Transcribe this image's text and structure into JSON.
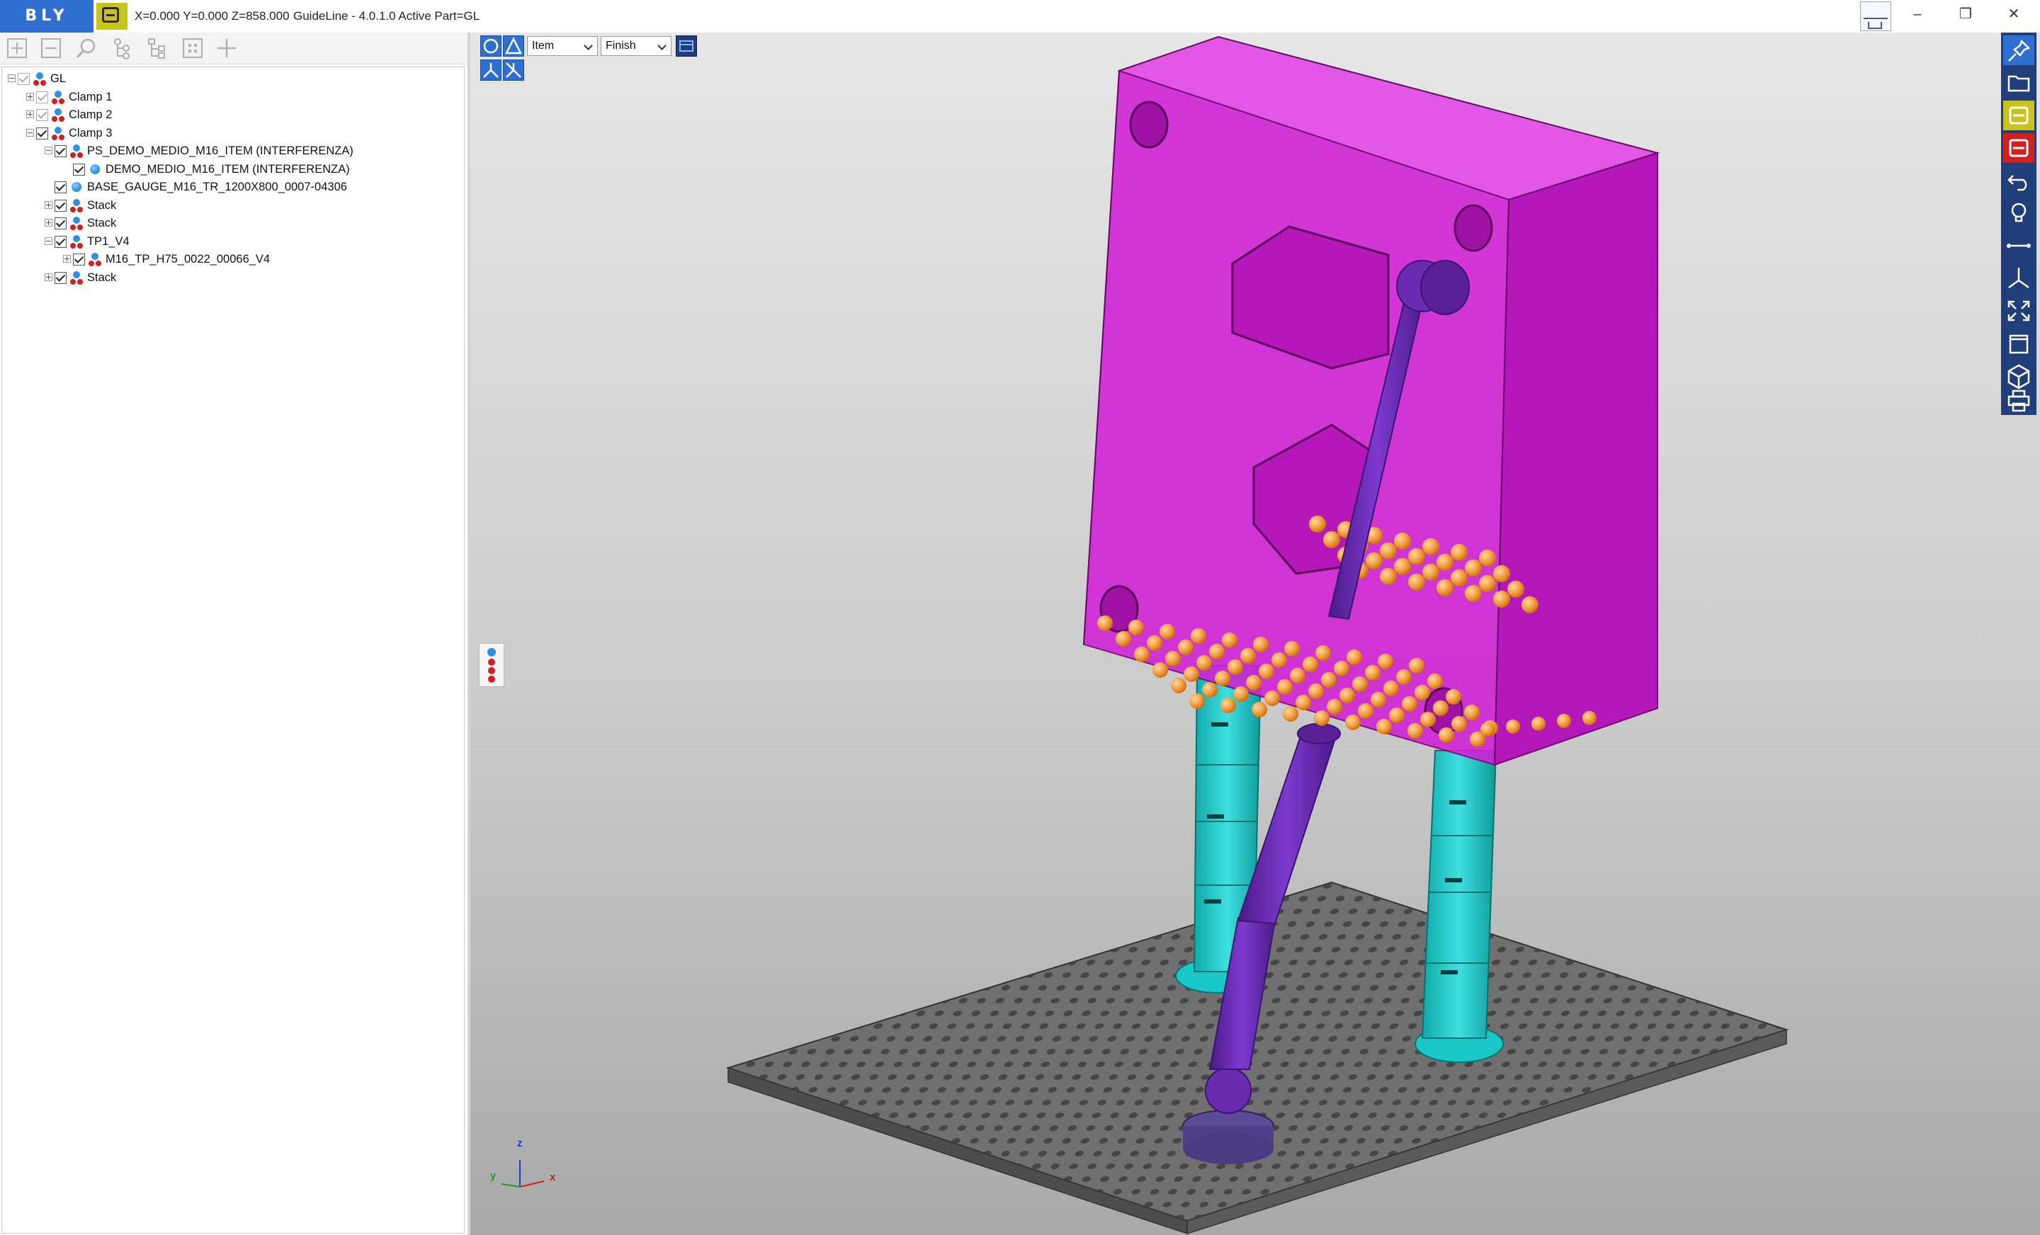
{
  "titlebar": {
    "logo_text": "BLY",
    "coordinates": "X=0.000 Y=0.000 Z=858.000",
    "title": "GuideLine - 4.0.1.0 Active Part=GL",
    "window_buttons": [
      "–",
      "❐",
      "✕"
    ]
  },
  "tree": {
    "items": [
      {
        "label": "GL",
        "level": 0,
        "expander": "minus",
        "icon": "assembly",
        "checked_dim": true
      },
      {
        "label": "Clamp 1",
        "level": 1,
        "expander": "plus",
        "icon": "assembly",
        "checked_dim": true
      },
      {
        "label": "Clamp 2",
        "level": 1,
        "expander": "plus",
        "icon": "assembly",
        "checked_dim": true
      },
      {
        "label": "Clamp 3",
        "level": 1,
        "expander": "minus",
        "icon": "assembly",
        "checked_dim": false
      },
      {
        "label": "PS_DEMO_MEDIO_M16_ITEM (INTERFERENZA)",
        "level": 2,
        "expander": "minus",
        "icon": "assembly",
        "checked_dim": false
      },
      {
        "label": "DEMO_MEDIO_M16_ITEM (INTERFERENZA)",
        "level": 3,
        "expander": "none",
        "icon": "part",
        "checked_dim": false
      },
      {
        "label": "BASE_GAUGE_M16_TR_1200X800_0007-04306",
        "level": 2,
        "expander": "none",
        "icon": "part",
        "checked_dim": false
      },
      {
        "label": "Stack",
        "level": 2,
        "expander": "plus",
        "icon": "assembly",
        "checked_dim": false
      },
      {
        "label": "Stack",
        "level": 2,
        "expander": "plus",
        "icon": "assembly",
        "checked_dim": false
      },
      {
        "label": "TP1_V4",
        "level": 2,
        "expander": "minus",
        "icon": "assembly",
        "checked_dim": false
      },
      {
        "label": "M16_TP_H75_0022_00066_V4",
        "level": 3,
        "expander": "plus",
        "icon": "assembly",
        "checked_dim": false
      },
      {
        "label": "Stack",
        "level": 2,
        "expander": "plus",
        "icon": "assembly",
        "checked_dim": false
      }
    ]
  },
  "viewport": {
    "selection_mode": "Item",
    "render_mode": "Finish",
    "axes": {
      "z": "z",
      "y": "y",
      "x": "x"
    }
  },
  "colors": {
    "brand_blue": "#2f6fcf",
    "fixture_magenta": "#d11fd6",
    "support_cyan": "#19c9c9",
    "clamp_purple": "#6a2bb0",
    "ball_orange": "#f29a3a",
    "plate_gray": "#6f6f6f"
  }
}
